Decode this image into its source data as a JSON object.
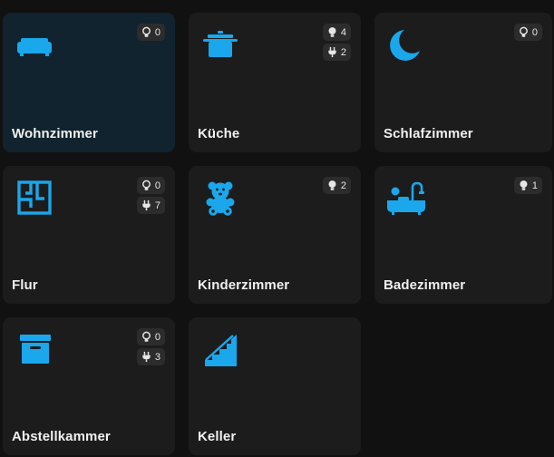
{
  "colors": {
    "accent": "#1aa7ec",
    "card": "#1c1c1c",
    "card_active": "#10232e",
    "background": "#111111"
  },
  "rooms": [
    {
      "name": "Wohnzimmer",
      "icon": "sofa-icon",
      "active": true,
      "badges": [
        {
          "icon": "lightbulb-icon",
          "count": "0"
        }
      ]
    },
    {
      "name": "Küche",
      "icon": "pot-icon",
      "badges": [
        {
          "icon": "lightbulb-icon",
          "count": "4"
        },
        {
          "icon": "plug-icon",
          "count": "2"
        }
      ]
    },
    {
      "name": "Schlafzimmer",
      "icon": "moon-icon",
      "badges": [
        {
          "icon": "lightbulb-icon",
          "count": "0"
        }
      ]
    },
    {
      "name": "Flur",
      "icon": "floor-plan-icon",
      "badges": [
        {
          "icon": "lightbulb-icon",
          "count": "0"
        },
        {
          "icon": "plug-icon",
          "count": "7"
        }
      ]
    },
    {
      "name": "Kinderzimmer",
      "icon": "teddy-bear-icon",
      "badges": [
        {
          "icon": "lightbulb-icon",
          "count": "2"
        }
      ]
    },
    {
      "name": "Badezimmer",
      "icon": "bathtub-icon",
      "badges": [
        {
          "icon": "lightbulb-icon",
          "count": "1"
        }
      ]
    },
    {
      "name": "Abstellkammer",
      "icon": "archive-box-icon",
      "badges": [
        {
          "icon": "lightbulb-icon",
          "count": "0"
        },
        {
          "icon": "plug-icon",
          "count": "3"
        }
      ]
    },
    {
      "name": "Keller",
      "icon": "stairs-icon",
      "badges": []
    }
  ]
}
